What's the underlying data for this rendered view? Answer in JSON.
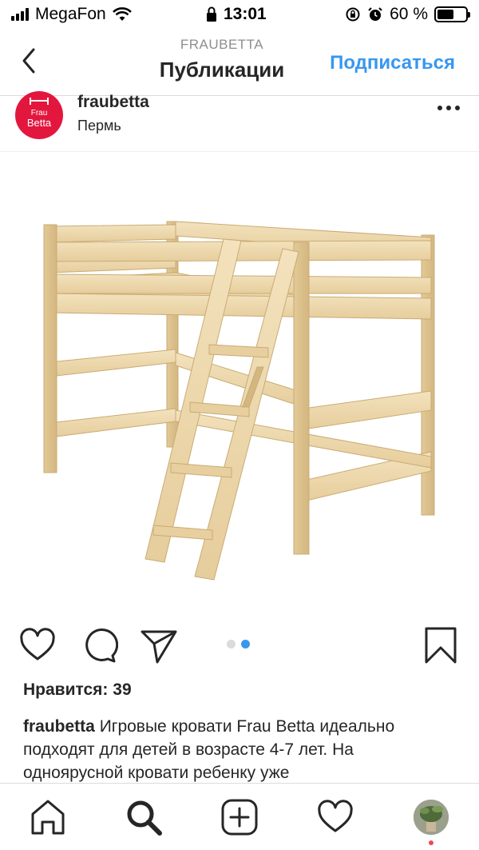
{
  "status_bar": {
    "carrier": "MegaFon",
    "time": "13:01",
    "battery_percent_label": "60 %",
    "battery_level": 0.6
  },
  "nav": {
    "subtitle": "FRAUBETTA",
    "title": "Публикации",
    "subscribe_label": "Подписаться"
  },
  "post": {
    "avatar_line1": "Frau",
    "avatar_line2": "Betta",
    "username": "fraubetta",
    "location": "Пермь",
    "carousel_count": 2,
    "carousel_active_index": 1,
    "likes_label": "Нравится: 39",
    "caption_user": "fraubetta",
    "caption_text": " Игровые кровати Frau Betta идеально подходят для детей в возрасте 4-7 лет. На одноярусной кровати ребенку уже"
  },
  "icons": {
    "back": "chevron-left-icon",
    "more": "more-horizontal-icon",
    "like": "heart-icon",
    "comment": "comment-icon",
    "share": "send-icon",
    "save": "bookmark-icon",
    "home": "home-icon",
    "search": "search-icon",
    "new_post": "add-post-icon",
    "activity": "heart-icon"
  },
  "colors": {
    "accent": "#3897f0",
    "brand_avatar": "#e3173e",
    "text": "#262626",
    "muted": "#8e8e8e",
    "notification": "#ed4956"
  }
}
